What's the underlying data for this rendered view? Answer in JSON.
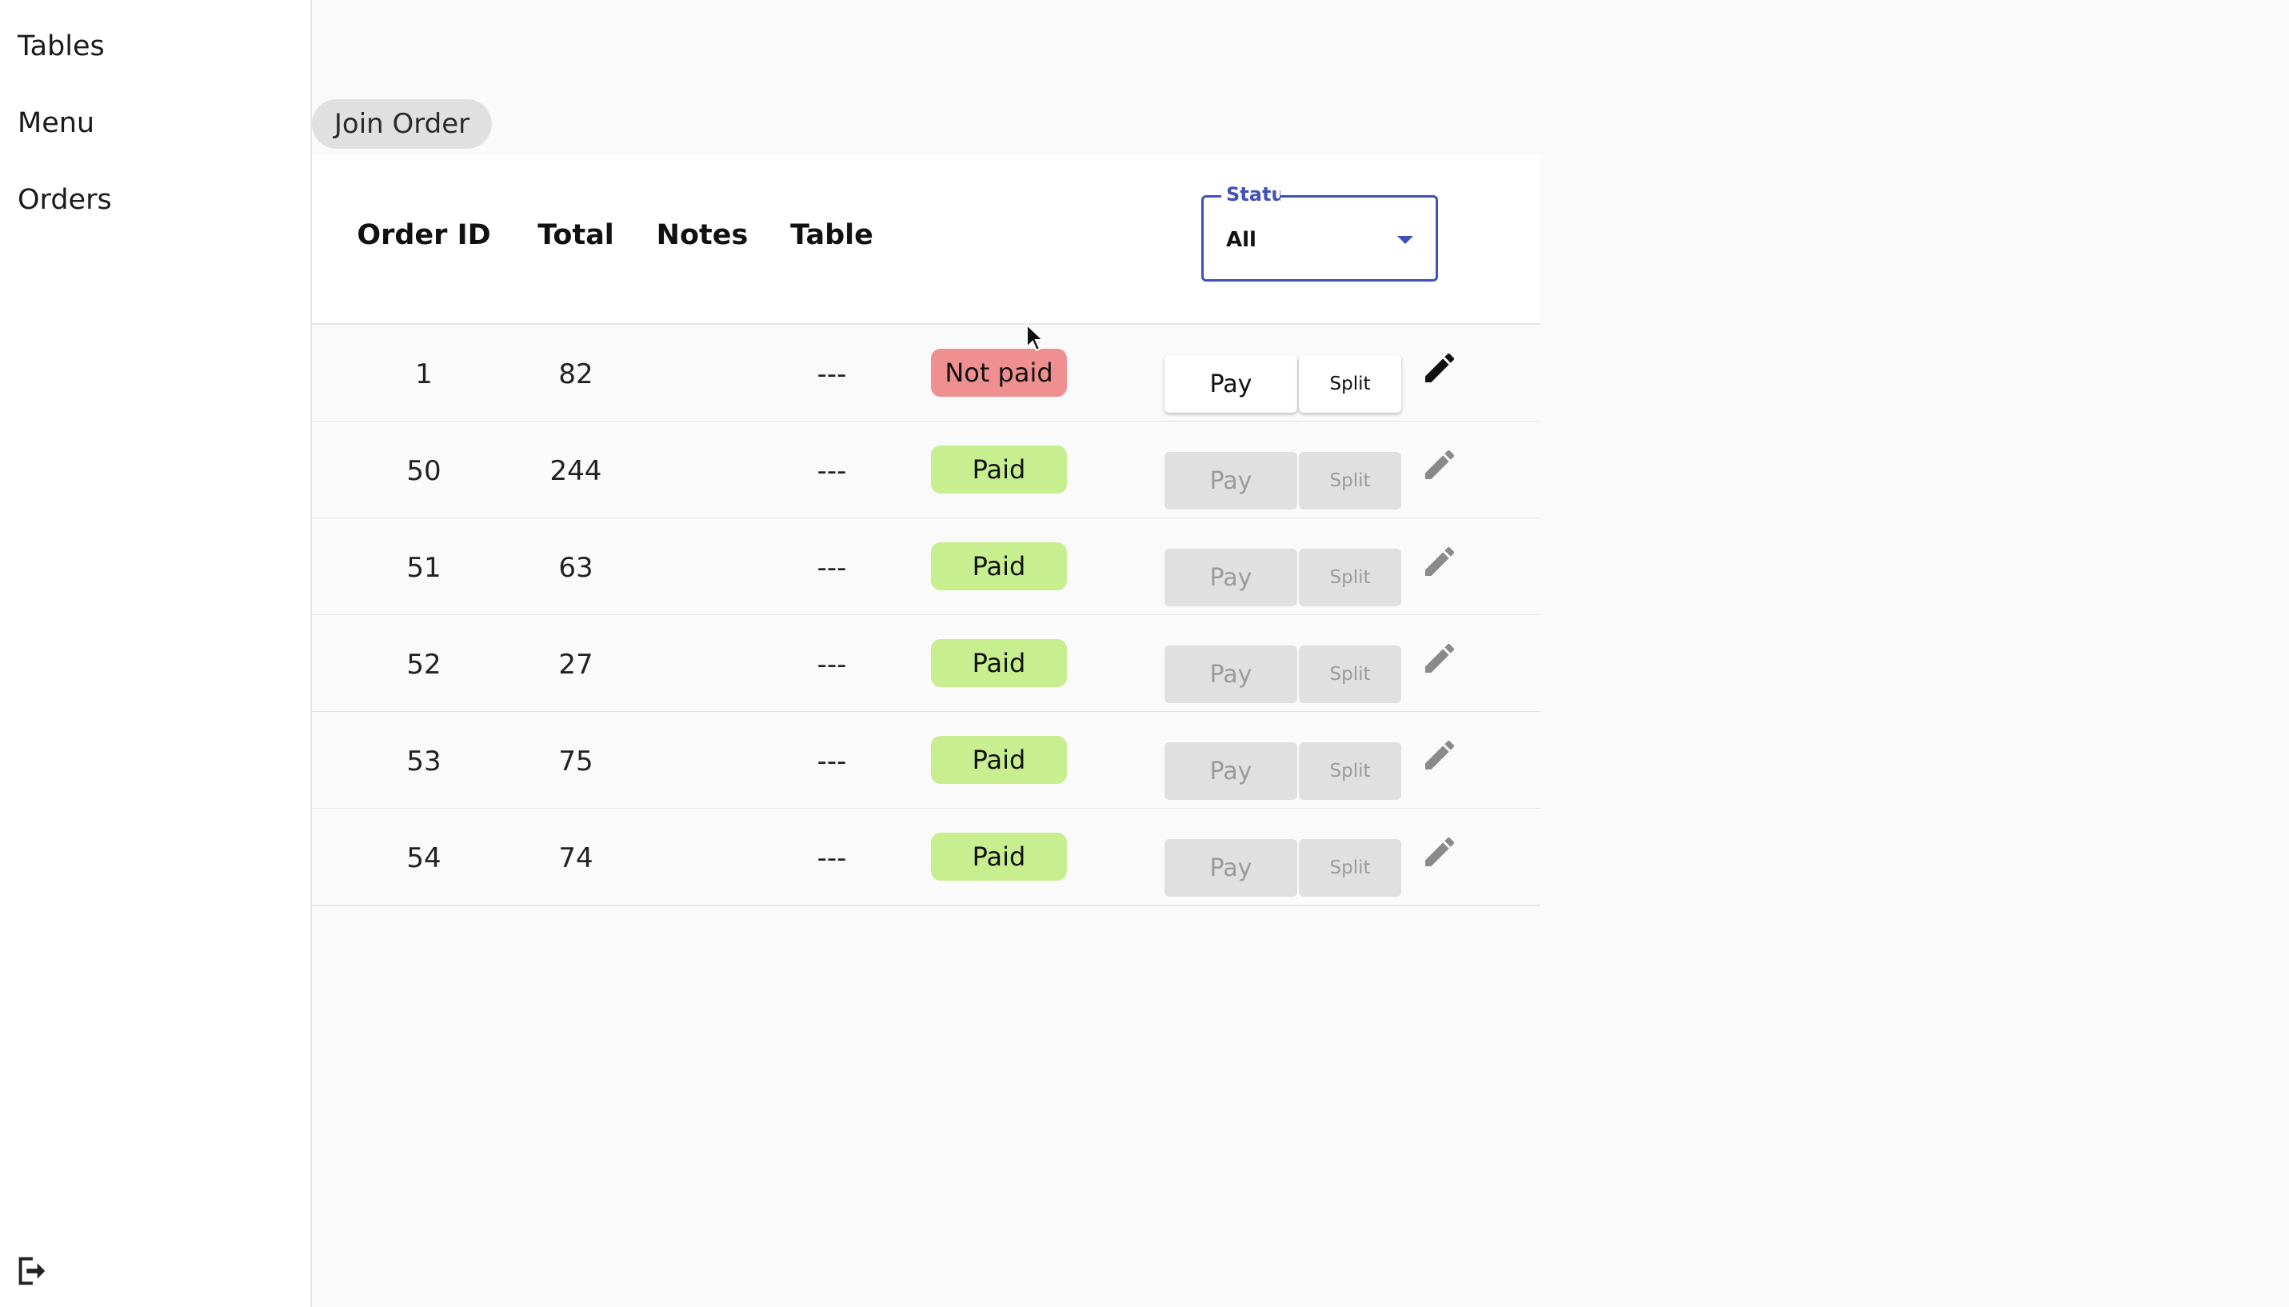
{
  "sidebar": {
    "items": [
      {
        "label": "Tables"
      },
      {
        "label": "Menu"
      },
      {
        "label": "Orders"
      }
    ],
    "logout_icon": "logout-icon"
  },
  "toolbar": {
    "join_label": "Join Order"
  },
  "table": {
    "columns": {
      "order_id": "Order ID",
      "total": "Total",
      "notes": "Notes",
      "table": "Table"
    },
    "status_filter": {
      "label": "Status",
      "value": "All"
    },
    "rows": [
      {
        "id": "1",
        "total": "82",
        "notes": "",
        "table": "---",
        "status": "Not paid",
        "paid": false,
        "pay": "Pay",
        "split": "Split"
      },
      {
        "id": "50",
        "total": "244",
        "notes": "",
        "table": "---",
        "status": "Paid",
        "paid": true,
        "pay": "Pay",
        "split": "Split"
      },
      {
        "id": "51",
        "total": "63",
        "notes": "",
        "table": "---",
        "status": "Paid",
        "paid": true,
        "pay": "Pay",
        "split": "Split"
      },
      {
        "id": "52",
        "total": "27",
        "notes": "",
        "table": "---",
        "status": "Paid",
        "paid": true,
        "pay": "Pay",
        "split": "Split"
      },
      {
        "id": "53",
        "total": "75",
        "notes": "",
        "table": "---",
        "status": "Paid",
        "paid": true,
        "pay": "Pay",
        "split": "Split"
      },
      {
        "id": "54",
        "total": "74",
        "notes": "",
        "table": "---",
        "status": "Paid",
        "paid": true,
        "pay": "Pay",
        "split": "Split"
      }
    ]
  },
  "colors": {
    "accent": "#3f51b5",
    "paid": "#c8ef8f",
    "not_paid": "#ef8f8f"
  }
}
